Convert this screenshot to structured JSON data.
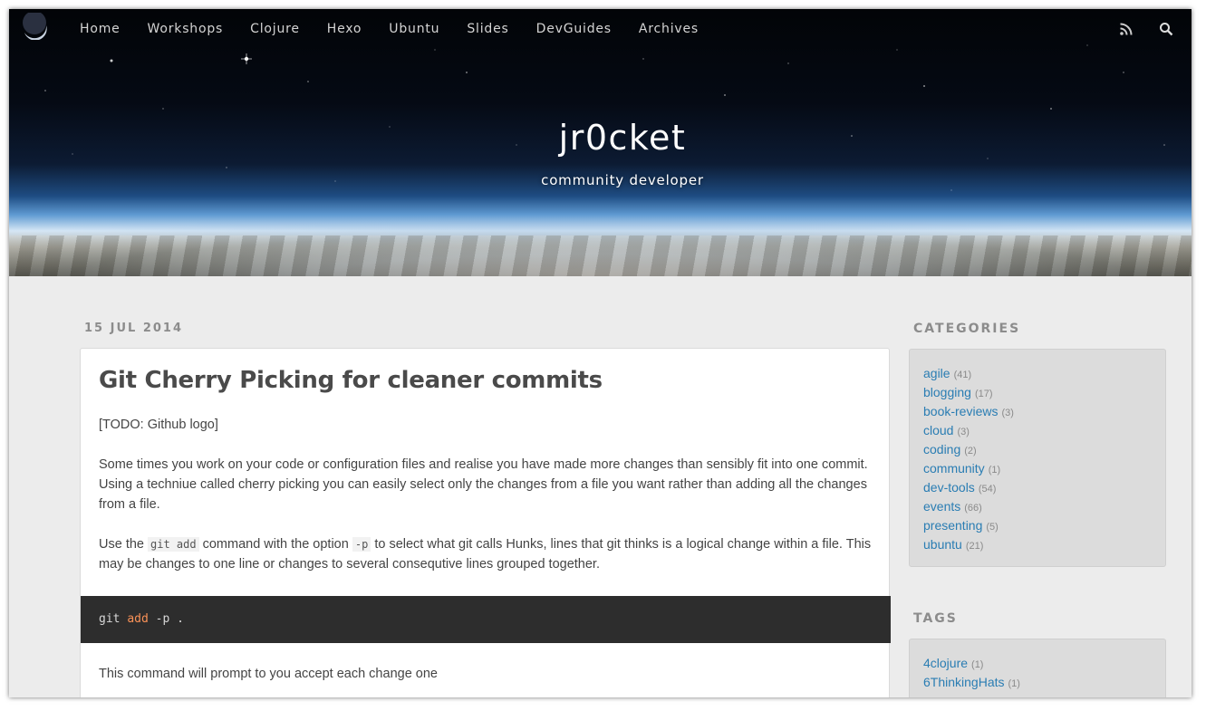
{
  "colors": {
    "page_background": "#ececec",
    "link": "#2a7db3",
    "code_background": "#2d2d2d",
    "code_keyword": "#f99157"
  },
  "nav": {
    "items": [
      {
        "label": "Home"
      },
      {
        "label": "Workshops"
      },
      {
        "label": "Clojure"
      },
      {
        "label": "Hexo"
      },
      {
        "label": "Ubuntu"
      },
      {
        "label": "Slides"
      },
      {
        "label": "DevGuides"
      },
      {
        "label": "Archives"
      }
    ],
    "icons": [
      "rss-icon",
      "search-icon"
    ]
  },
  "site": {
    "title": "jr0cket",
    "subtitle": "community developer"
  },
  "post": {
    "date": "15 JUL 2014",
    "title": "Git Cherry Picking for cleaner commits",
    "todo": "[TODO: Github logo]",
    "para1": "Some times you work on your code or configuration files and realise you have made more changes than sensibly fit into one commit. Using a techniue called cherry picking you can easily select only the changes from a file you want rather than adding all the changes from a file.",
    "para2": {
      "t1": "Use the ",
      "c1": "git add",
      "t2": " command with the option ",
      "c2": "-p",
      "t3": " to select what git calls Hunks, lines that git thinks is a logical change within a file. This may be changes to one line or changes to several consequtive lines grouped together."
    },
    "code": {
      "cmd": "git",
      "kw": "add",
      "rest": "-p ."
    },
    "para3": "This command will prompt to you accept each change one"
  },
  "sidebar": {
    "categories_heading": "CATEGORIES",
    "categories": [
      {
        "name": "agile",
        "count": "(41)"
      },
      {
        "name": "blogging",
        "count": "(17)"
      },
      {
        "name": "book-reviews",
        "count": "(3)"
      },
      {
        "name": "cloud",
        "count": "(3)"
      },
      {
        "name": "coding",
        "count": "(2)"
      },
      {
        "name": "community",
        "count": "(1)"
      },
      {
        "name": "dev-tools",
        "count": "(54)"
      },
      {
        "name": "events",
        "count": "(66)"
      },
      {
        "name": "presenting",
        "count": "(5)"
      },
      {
        "name": "ubuntu",
        "count": "(21)"
      }
    ],
    "tags_heading": "TAGS",
    "tags": [
      {
        "name": "4clojure",
        "count": "(1)"
      },
      {
        "name": "6ThinkingHats",
        "count": "(1)"
      }
    ]
  }
}
